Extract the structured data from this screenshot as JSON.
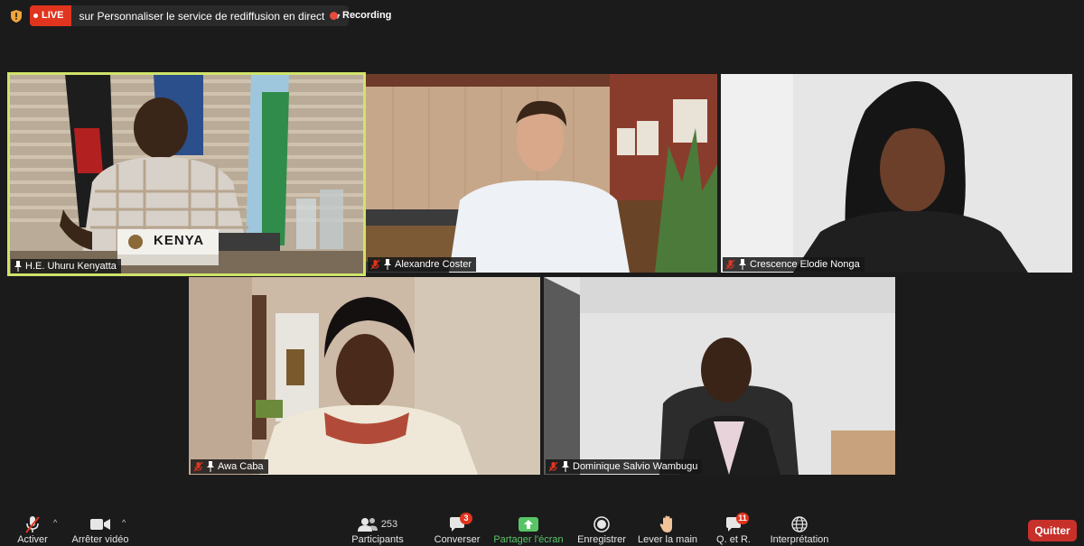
{
  "topbar": {
    "live_label": "LIVE",
    "live_text": "sur Personnaliser le service de rediffusion en direct",
    "recording_label": "Recording",
    "colors": {
      "live": "#e1341e",
      "recording": "#e8493d"
    }
  },
  "participants": [
    {
      "name": "H.E. Uhuru Kenyatta",
      "active_speaker": true,
      "muted": false,
      "sign": "KENYA"
    },
    {
      "name": "Alexandre Coster",
      "active_speaker": false,
      "muted": true
    },
    {
      "name": "Crescence Elodie Nonga",
      "active_speaker": false,
      "muted": true
    },
    {
      "name": "Awa Caba",
      "active_speaker": false,
      "muted": true
    },
    {
      "name": "Dominique Salvio Wambugu",
      "active_speaker": false,
      "muted": true
    }
  ],
  "toolbar": {
    "mute": {
      "label": "Activer",
      "icon": "muted-microphone-icon"
    },
    "video": {
      "label": "Arrêter vidéo",
      "icon": "video-camera-icon"
    },
    "participants": {
      "label": "Participants",
      "count": "253",
      "icon": "participants-icon"
    },
    "chat": {
      "label": "Converser",
      "badge": "3",
      "icon": "chat-icon"
    },
    "share": {
      "label": "Partager l'écran",
      "icon": "share-screen-icon",
      "color": "#59c466"
    },
    "record": {
      "label": "Enregistrer",
      "icon": "record-icon"
    },
    "raise_hand": {
      "label": "Lever la main",
      "icon": "raise-hand-icon"
    },
    "qa": {
      "label": "Q. et R.",
      "badge": "11",
      "icon": "qa-icon"
    },
    "interpretation": {
      "label": "Interprétation",
      "icon": "globe-icon"
    },
    "quit": {
      "label": "Quitter",
      "color": "#c8302a"
    }
  }
}
